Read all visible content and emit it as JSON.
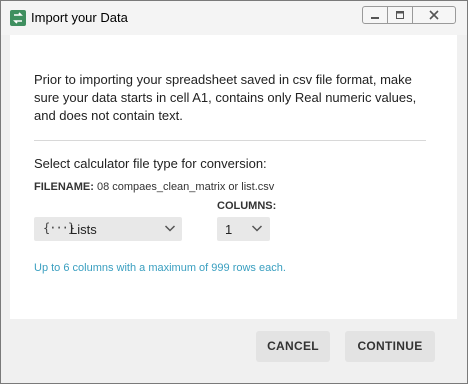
{
  "window": {
    "title": "Import your Data"
  },
  "dialog": {
    "intro": "Prior to importing your spreadsheet saved in csv file format, make sure your data starts in cell A1, contains only Real numeric values, and does not contain text.",
    "select_label": "Select calculator file type for conversion:",
    "filename_label": "FILENAME:",
    "filename_value": "08 compaes_clean_matrix or list.csv",
    "columns_label": "COLUMNS:",
    "type_dropdown": {
      "icon": "{···}",
      "selected": "Lists"
    },
    "columns_dropdown": {
      "selected": "1"
    },
    "note": "Up to 6 columns with a maximum of 999 rows each."
  },
  "buttons": {
    "cancel": "CANCEL",
    "continue": "CONTINUE"
  },
  "colors": {
    "note": "#3a9fc0",
    "app_icon": "#3f8f5f"
  }
}
